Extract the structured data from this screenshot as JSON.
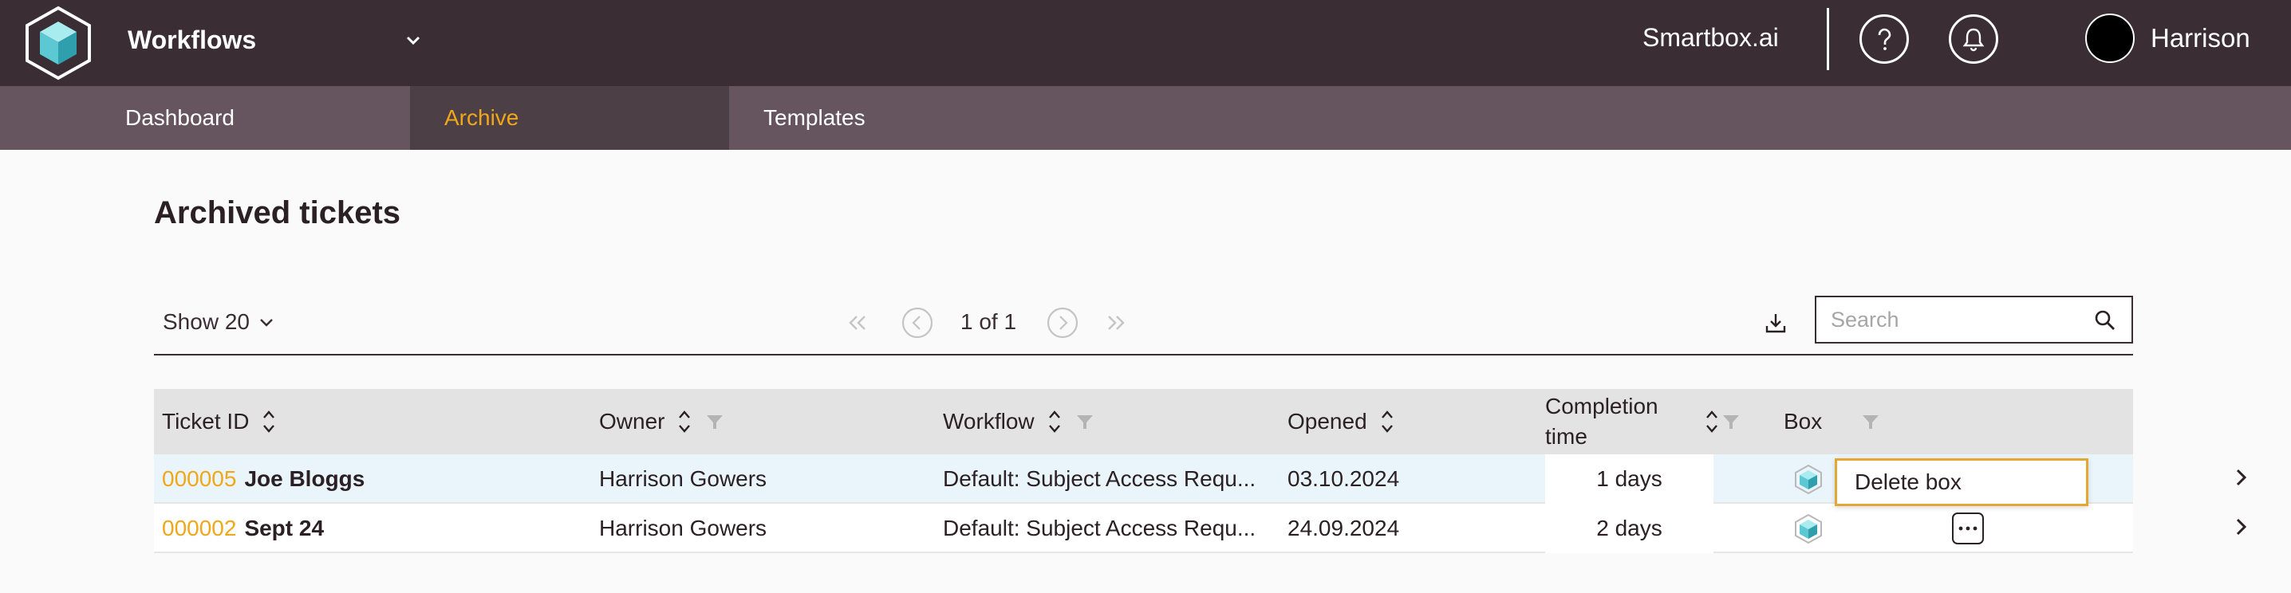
{
  "header": {
    "app_title": "Workflows",
    "brand": "Smartbox.ai",
    "user_name": "Harrison",
    "icons": [
      "cube-logo-icon",
      "chevron-down-icon",
      "help-icon",
      "bell-icon"
    ]
  },
  "nav": {
    "tabs": [
      {
        "label": "Dashboard"
      },
      {
        "label": "Archive",
        "active": true
      },
      {
        "label": "Templates"
      }
    ]
  },
  "page": {
    "title": "Archived tickets"
  },
  "toolbar": {
    "show_label": "Show 20",
    "page_info": "1 of 1",
    "search_placeholder": "Search"
  },
  "table": {
    "columns": [
      {
        "label": "Ticket ID"
      },
      {
        "label": "Owner"
      },
      {
        "label": "Workflow"
      },
      {
        "label": "Opened"
      },
      {
        "label": "Completion time"
      },
      {
        "label": "Box"
      }
    ],
    "rows": [
      {
        "ticket_id": "000005",
        "name": "Joe Bloggs",
        "owner": "Harrison Gowers",
        "workflow": "Default: Subject Access Requ...",
        "opened": "03.10.2024",
        "completion": "1 days"
      },
      {
        "ticket_id": "000002",
        "name": "Sept 24",
        "owner": "Harrison Gowers",
        "workflow": "Default: Subject Access Requ...",
        "opened": "24.09.2024",
        "completion": "2 days"
      }
    ]
  },
  "popup": {
    "label": "Delete box"
  },
  "colors": {
    "header_bg": "#3a2d33",
    "nav_bg": "#66555e",
    "nav_active_bg": "#4d3f46",
    "accent": "#f0a71a",
    "row_highlight": "#eaf5fb",
    "box_cyan": "#5bc8d3"
  }
}
